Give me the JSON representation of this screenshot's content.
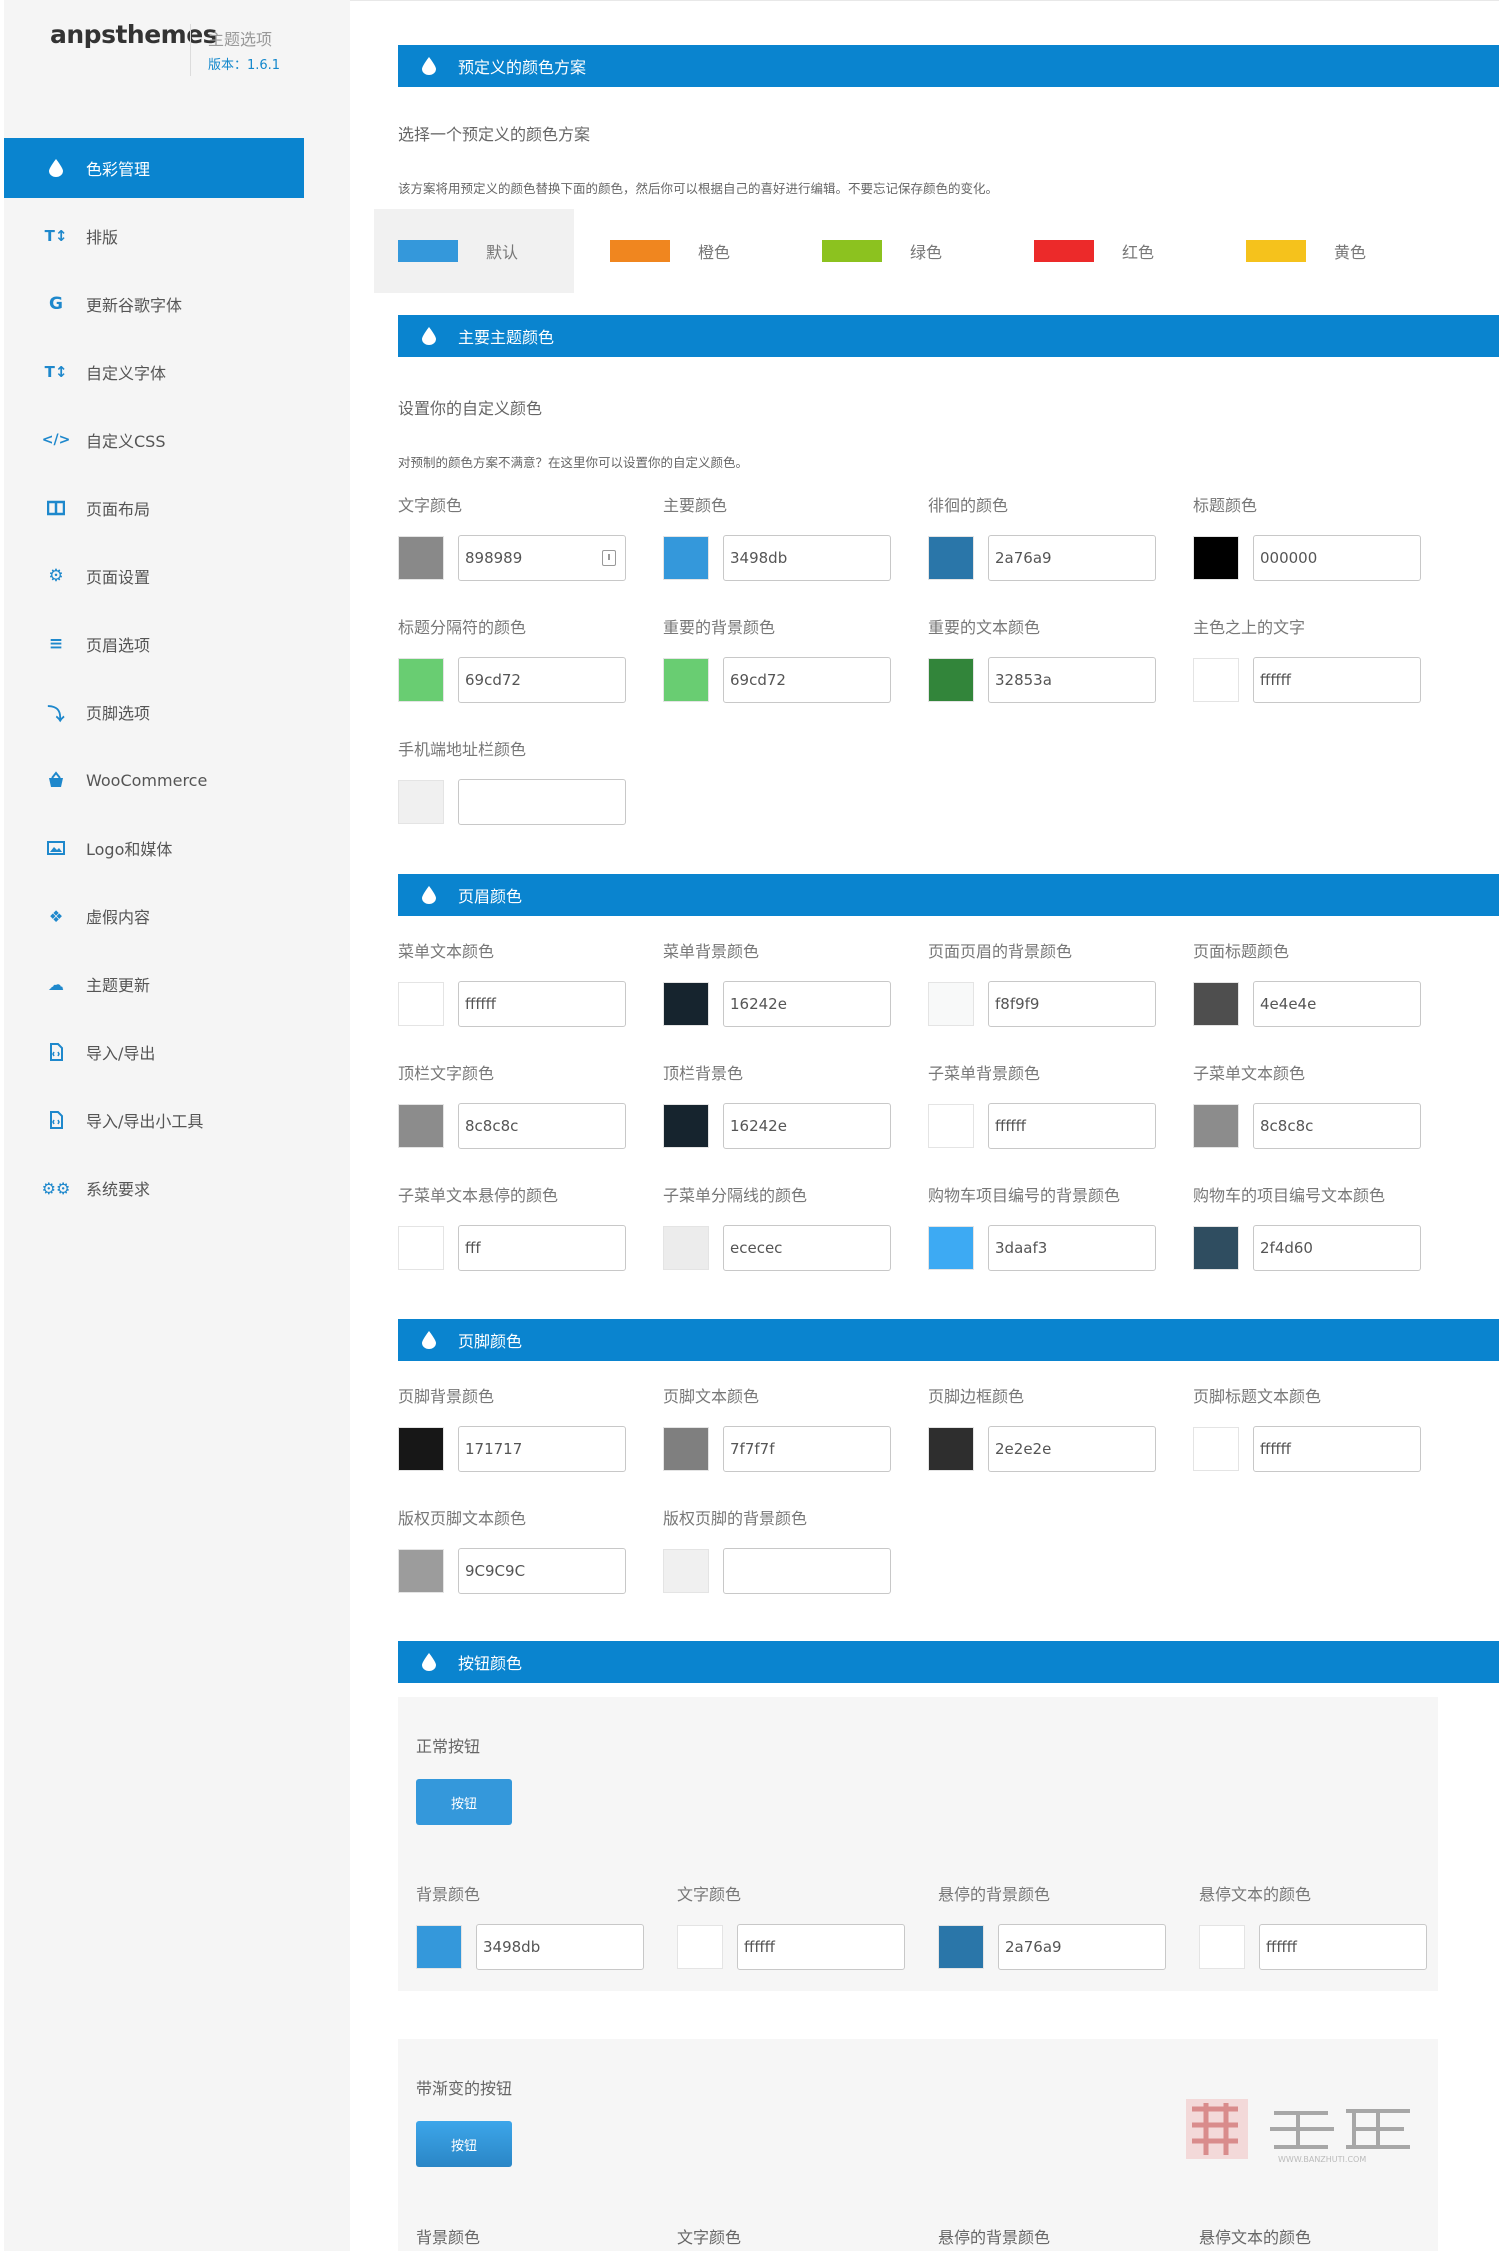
{
  "brand": {
    "logo": "anpsthemes",
    "subtitle": "主题选项",
    "version": "版本：1.6.1"
  },
  "sidebar": {
    "items": [
      {
        "label": "色彩管理",
        "icon": "drop-icon"
      },
      {
        "label": "排版",
        "icon": "text-height-icon"
      },
      {
        "label": "更新谷歌字体",
        "icon": "google-icon"
      },
      {
        "label": "自定义字体",
        "icon": "text-height-icon"
      },
      {
        "label": "自定义CSS",
        "icon": "code-icon"
      },
      {
        "label": "页面布局",
        "icon": "columns-icon"
      },
      {
        "label": "页面设置",
        "icon": "gear-icon"
      },
      {
        "label": "页眉选项",
        "icon": "bars-icon"
      },
      {
        "label": "页脚选项",
        "icon": "level-down-icon"
      },
      {
        "label": "WooCommerce",
        "icon": "basket-icon"
      },
      {
        "label": "Logo和媒体",
        "icon": "image-icon"
      },
      {
        "label": "虚假内容",
        "icon": "dropbox-icon"
      },
      {
        "label": "主题更新",
        "icon": "cloud-download-icon"
      },
      {
        "label": "导入/导出",
        "icon": "file-code-icon"
      },
      {
        "label": "导入/导出小工具",
        "icon": "file-code-icon"
      },
      {
        "label": "系统要求",
        "icon": "gears-icon"
      }
    ]
  },
  "sections": {
    "predefined": {
      "title": "预定义的颜色方案",
      "heading": "选择一个预定义的颜色方案",
      "desc": "该方案将用预定义的颜色替换下面的颜色，然后你可以根据自己的喜好进行编辑。不要忘记保存颜色的变化。",
      "schemes": [
        {
          "label": "默认",
          "color": "#3498db"
        },
        {
          "label": "橙色",
          "color": "#f0861f"
        },
        {
          "label": "绿色",
          "color": "#8cc21f"
        },
        {
          "label": "红色",
          "color": "#ec2a2a"
        },
        {
          "label": "黄色",
          "color": "#f5c21c"
        }
      ]
    },
    "main": {
      "title": "主要主题颜色",
      "heading": "设置你的自定义颜色",
      "desc": "对预制的颜色方案不满意？在这里你可以设置你的自定义颜色。",
      "fields": [
        {
          "label": "文字颜色",
          "value": "898989",
          "color": "#898989"
        },
        {
          "label": "主要颜色",
          "value": "3498db",
          "color": "#3498db"
        },
        {
          "label": "徘徊的颜色",
          "value": "2a76a9",
          "color": "#2a76a9"
        },
        {
          "label": "标题颜色",
          "value": "000000",
          "color": "#000000"
        },
        {
          "label": "标题分隔符的颜色",
          "value": "69cd72",
          "color": "#69cd72"
        },
        {
          "label": "重要的背景颜色",
          "value": "69cd72",
          "color": "#69cd72"
        },
        {
          "label": "重要的文本颜色",
          "value": "32853a",
          "color": "#32853a"
        },
        {
          "label": "主色之上的文字",
          "value": "ffffff",
          "color": "#ffffff"
        },
        {
          "label": "手机端地址栏颜色",
          "value": "",
          "color": "#f0f0f0"
        }
      ]
    },
    "header": {
      "title": "页眉颜色",
      "fields": [
        {
          "label": "菜单文本颜色",
          "value": "ffffff",
          "color": "#ffffff"
        },
        {
          "label": "菜单背景颜色",
          "value": "16242e",
          "color": "#16242e"
        },
        {
          "label": "页面页眉的背景颜色",
          "value": "f8f9f9",
          "color": "#f8f9f9"
        },
        {
          "label": "页面标题颜色",
          "value": "4e4e4e",
          "color": "#4e4e4e"
        },
        {
          "label": "顶栏文字颜色",
          "value": "8c8c8c",
          "color": "#8c8c8c"
        },
        {
          "label": "顶栏背景色",
          "value": "16242e",
          "color": "#16242e"
        },
        {
          "label": "子菜单背景颜色",
          "value": "ffffff",
          "color": "#ffffff"
        },
        {
          "label": "子菜单文本颜色",
          "value": "8c8c8c",
          "color": "#8c8c8c"
        },
        {
          "label": "子菜单文本悬停的颜色",
          "value": "fff",
          "color": "#ffffff"
        },
        {
          "label": "子菜单分隔线的颜色",
          "value": "ececec",
          "color": "#ececec"
        },
        {
          "label": "购物车项目编号的背景颜色",
          "value": "3daaf3",
          "color": "#3daaf3"
        },
        {
          "label": "购物车的项目编号文本颜色",
          "value": "2f4d60",
          "color": "#2f4d60"
        }
      ]
    },
    "footer": {
      "title": "页脚颜色",
      "fields": [
        {
          "label": "页脚背景颜色",
          "value": "171717",
          "color": "#171717"
        },
        {
          "label": "页脚文本颜色",
          "value": "7f7f7f",
          "color": "#7f7f7f"
        },
        {
          "label": "页脚边框颜色",
          "value": "2e2e2e",
          "color": "#2e2e2e"
        },
        {
          "label": "页脚标题文本颜色",
          "value": "ffffff",
          "color": "#ffffff"
        },
        {
          "label": "版权页脚文本颜色",
          "value": "9C9C9C",
          "color": "#9c9c9c"
        },
        {
          "label": "版权页脚的背景颜色",
          "value": "",
          "color": "#f0f0f0"
        }
      ]
    },
    "buttons": {
      "title": "按钮颜色",
      "normal": {
        "title": "正常按钮",
        "button_label": "按钮",
        "fields": [
          {
            "label": "背景颜色",
            "value": "3498db",
            "color": "#3498db"
          },
          {
            "label": "文字颜色",
            "value": "ffffff",
            "color": "#ffffff"
          },
          {
            "label": "悬停的背景颜色",
            "value": "2a76a9",
            "color": "#2a76a9"
          },
          {
            "label": "悬停文本的颜色",
            "value": "ffffff",
            "color": "#ffffff"
          }
        ]
      },
      "gradient": {
        "title": "带渐变的按钮",
        "button_label": "按钮",
        "field_labels": [
          "背景颜色",
          "文字颜色",
          "悬停的背景颜色",
          "悬停文本的颜色"
        ]
      }
    }
  },
  "watermark": {
    "text": "主题",
    "url": "WWW.BANZHUTI.COM"
  }
}
